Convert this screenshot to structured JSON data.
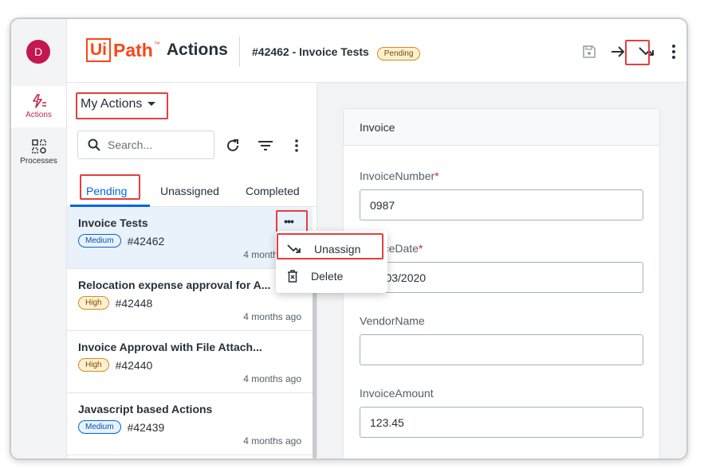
{
  "rail": {
    "avatar_initial": "D",
    "items": [
      {
        "label": "Actions",
        "icon": "actions-icon",
        "active": true
      },
      {
        "label": "Processes",
        "icon": "processes-icon",
        "active": false
      }
    ]
  },
  "header": {
    "logo_ui": "Ui",
    "logo_path": "Path",
    "logo_tm": "™",
    "logo_product": "Actions",
    "task_title": "#42462 - Invoice Tests",
    "task_status": "Pending",
    "icons": [
      "save-icon",
      "arrow-right-icon",
      "unassign-icon",
      "more-vertical-icon"
    ]
  },
  "list_panel": {
    "view_selector": "My Actions",
    "search_placeholder": "Search...",
    "tabs": [
      {
        "label": "Pending",
        "active": true
      },
      {
        "label": "Unassigned",
        "active": false
      },
      {
        "label": "Completed",
        "active": false
      }
    ],
    "tasks": [
      {
        "title": "Invoice Tests",
        "priority": "Medium",
        "id": "#42462",
        "time": "4 months ago",
        "selected": true
      },
      {
        "title": "Relocation expense approval for A...",
        "priority": "High",
        "id": "#42448",
        "time": "4 months ago",
        "selected": false
      },
      {
        "title": "Invoice Approval with File Attach...",
        "priority": "High",
        "id": "#42440",
        "time": "4 months ago",
        "selected": false
      },
      {
        "title": "Javascript based Actions",
        "priority": "Medium",
        "id": "#42439",
        "time": "4 months ago",
        "selected": false
      }
    ],
    "more_button": "•••"
  },
  "context_menu": {
    "items": [
      {
        "label": "Unassign",
        "icon": "unassign-icon"
      },
      {
        "label": "Delete",
        "icon": "trash-icon"
      }
    ]
  },
  "form": {
    "section_title": "Invoice",
    "fields": [
      {
        "label": "InvoiceNumber",
        "required": "*",
        "value": "0987"
      },
      {
        "label": "InvoiceDate",
        "required": "*",
        "value": "03/03/2020"
      },
      {
        "label": "VendorName",
        "required": "",
        "value": ""
      },
      {
        "label": "InvoiceAmount",
        "required": "",
        "value": "123.45"
      }
    ]
  },
  "colors": {
    "brand_orange": "#fa4616",
    "accent_blue": "#0067df",
    "highlight_red": "#e53e3e",
    "avatar": "#c4174f"
  }
}
